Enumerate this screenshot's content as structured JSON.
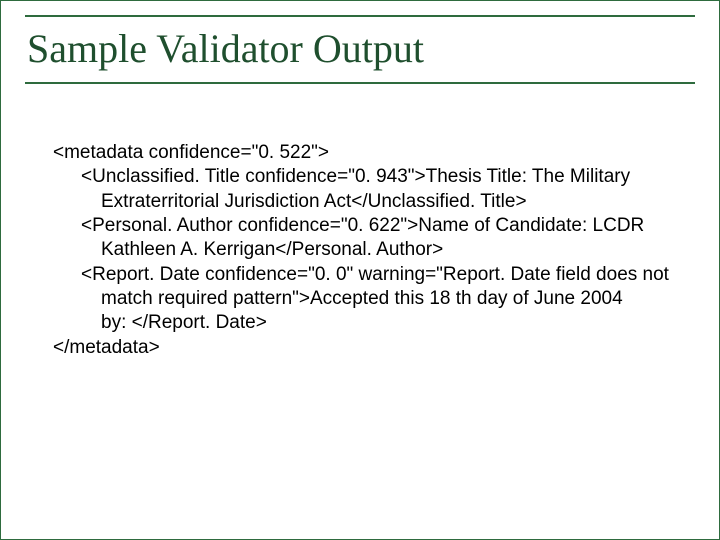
{
  "title": "Sample Validator Output",
  "lines": {
    "l1": "<metadata confidence=\"0. 522\">",
    "l2": "<Unclassified. Title confidence=\"0. 943\">Thesis Title: The Military",
    "l3": "Extraterritorial Jurisdiction Act</Unclassified. Title>",
    "l4": "<Personal. Author confidence=\"0. 622\">Name of  Candidate: LCDR",
    "l5": "Kathleen A. Kerrigan</Personal. Author>",
    "l6": "<Report. Date confidence=\"0. 0\" warning=\"Report. Date field does not",
    "l7": "match required pattern\">Accepted this 18 th day of June 2004",
    "l8": "by: </Report. Date>",
    "l9": "</metadata>"
  }
}
